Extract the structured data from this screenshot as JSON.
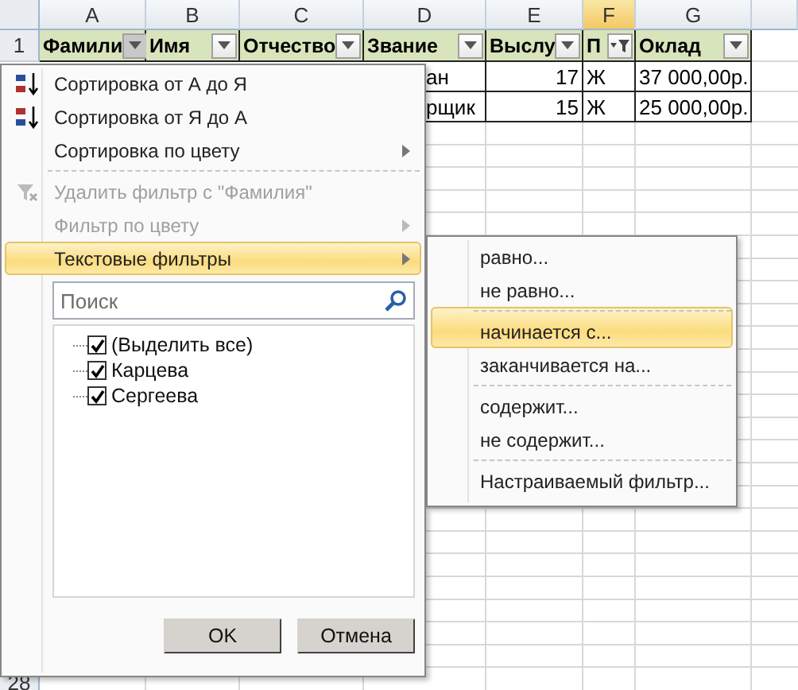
{
  "columns": [
    {
      "letter": "A",
      "selected": false
    },
    {
      "letter": "B",
      "selected": false
    },
    {
      "letter": "C",
      "selected": false
    },
    {
      "letter": "D",
      "selected": false
    },
    {
      "letter": "E",
      "selected": false
    },
    {
      "letter": "F",
      "selected": true
    },
    {
      "letter": "G",
      "selected": false
    }
  ],
  "header_row": {
    "number": "1",
    "cells": [
      {
        "label": "Фамили",
        "filtered": false,
        "open": true
      },
      {
        "label": "Имя",
        "filtered": false,
        "open": false
      },
      {
        "label": "Отчество",
        "filtered": false,
        "open": false
      },
      {
        "label": "Звание",
        "filtered": false,
        "open": false
      },
      {
        "label": "Выслу",
        "filtered": false,
        "open": false
      },
      {
        "label": "П",
        "filtered": true,
        "open": false
      },
      {
        "label": "Оклад",
        "filtered": false,
        "open": false
      }
    ]
  },
  "rows": [
    {
      "cells": [
        "ан",
        "17",
        "Ж",
        "37 000,00р."
      ]
    },
    {
      "cells": [
        "рщик",
        "15",
        "Ж",
        "25 000,00р."
      ]
    }
  ],
  "last_row_number": "28",
  "filter_menu": {
    "items": [
      {
        "label": "Сортировка от А до Я",
        "kind": "sort-ascending",
        "disabled": false,
        "submenu": false,
        "selected": false,
        "separator_before": false
      },
      {
        "label": "Сортировка от Я до А",
        "kind": "sort-descending",
        "disabled": false,
        "submenu": false,
        "selected": false,
        "separator_before": false
      },
      {
        "label": "Сортировка по цвету",
        "kind": "plain",
        "disabled": false,
        "submenu": true,
        "selected": false,
        "separator_before": false
      },
      {
        "label": "Удалить фильтр с \"Фамилия\"",
        "kind": "clear-filter",
        "disabled": true,
        "submenu": false,
        "selected": false,
        "separator_before": true
      },
      {
        "label": "Фильтр по цвету",
        "kind": "plain",
        "disabled": true,
        "submenu": true,
        "selected": false,
        "separator_before": false
      },
      {
        "label": "Текстовые фильтры",
        "kind": "plain",
        "disabled": false,
        "submenu": true,
        "selected": true,
        "separator_before": false
      }
    ],
    "search": {
      "placeholder": "Поиск"
    },
    "values": [
      {
        "label": "(Выделить все)",
        "checked": true
      },
      {
        "label": "Карцева",
        "checked": true
      },
      {
        "label": "Сергеева",
        "checked": true
      }
    ],
    "buttons": [
      "OK",
      "Отмена"
    ]
  },
  "text_filters": {
    "items": [
      {
        "label": "равно...",
        "selected": false,
        "separator_before": false
      },
      {
        "label": "не равно...",
        "selected": false,
        "separator_before": false
      },
      {
        "label": "начинается с...",
        "selected": true,
        "separator_before": true
      },
      {
        "label": "заканчивается на...",
        "selected": false,
        "separator_before": false
      },
      {
        "label": "содержит...",
        "selected": false,
        "separator_before": true
      },
      {
        "label": "не содержит...",
        "selected": false,
        "separator_before": false
      },
      {
        "label": "Настраиваемый фильтр...",
        "selected": false,
        "separator_before": true
      }
    ]
  }
}
